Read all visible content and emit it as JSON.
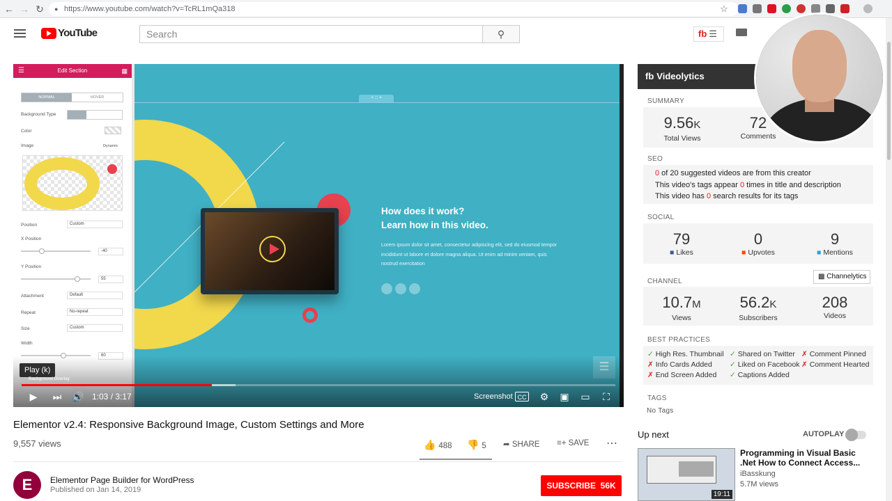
{
  "browser": {
    "url": "https://www.youtube.com/watch?v=TcRL1mQa318"
  },
  "header": {
    "logo_text": "YouTube",
    "search_placeholder": "Search"
  },
  "editor": {
    "panel_title": "Edit Section",
    "tab_normal": "NORMAL",
    "tab_hover": "HOVER",
    "background_type_label": "Background Type",
    "color_label": "Color",
    "image_label": "Image",
    "dynamic_label": "Dynamic",
    "position_label": "Position",
    "position_value": "Custom",
    "x_position_label": "X Position",
    "x_position_value": "-40",
    "y_position_label": "Y Position",
    "y_position_value": "55",
    "attachment_label": "Attachment",
    "attachment_value": "Default",
    "repeat_label": "Repeat",
    "repeat_value": "No-repeat",
    "size_label": "Size",
    "size_value": "Custom",
    "width_label": "Width",
    "width_value": "60",
    "background_overlay_label": "Background Overlay"
  },
  "stage": {
    "hero_title_line1": "How does it work?",
    "hero_title_line2": "Learn how in this video.",
    "hero_body": "Lorem ipsum dolor sit amet, consectetur adipiscing elit, sed do eiusmod tempor incididunt ut labore et dolore magna aliqua. Ut enim ad minim veniam, quis nostrud exercitation",
    "colors": {
      "background": "#40b0c4",
      "yellow": "#f2d84b",
      "red": "#e8414f"
    }
  },
  "player": {
    "tooltip": "Play (k)",
    "time": "1:03 / 3:17",
    "screenshot_label": "Screenshot",
    "progress_fraction": 0.32,
    "buffer_fraction": 0.36
  },
  "video": {
    "title": "Elementor v2.4: Responsive Background Image, Custom Settings and More",
    "views": "9,557 views",
    "likes": "488",
    "dislikes": "5",
    "share_label": "SHARE",
    "save_label": "SAVE"
  },
  "channel": {
    "avatar_letter": "E",
    "name": "Elementor Page Builder for WordPress",
    "published": "Published on Jan 14, 2019",
    "subscribe_label": "SUBSCRIBE",
    "subscriber_count": "56K"
  },
  "videolytics": {
    "title": "Videolytics",
    "summary_label": "SUMMARY",
    "summary": [
      {
        "value": "9.56",
        "suffix": "K",
        "label": "Total Views"
      },
      {
        "value": "72",
        "suffix": "",
        "label": "Comments"
      }
    ],
    "seo_label": "SEO",
    "seo_lines": [
      {
        "num": "0",
        "text": " of 20 suggested videos are from this creator",
        "prefix": ""
      },
      {
        "prefix": "This video's tags appear ",
        "num": "0",
        "text": " times in title and description"
      },
      {
        "prefix": "This video has ",
        "num": "0",
        "text": " search results for its tags"
      }
    ],
    "social_label": "SOCIAL",
    "social": [
      {
        "value": "79",
        "label": "Likes"
      },
      {
        "value": "0",
        "label": "Upvotes"
      },
      {
        "value": "9",
        "label": "Mentions"
      }
    ],
    "channel_label": "CHANNEL",
    "channelytics_button": "Channelytics",
    "channel_stats": [
      {
        "value": "10.7",
        "suffix": "M",
        "label": "Views"
      },
      {
        "value": "56.2",
        "suffix": "K",
        "label": "Subscribers"
      },
      {
        "value": "208",
        "suffix": "",
        "label": "Videos"
      }
    ],
    "best_practices_label": "BEST PRACTICES",
    "best_practices": [
      {
        "ok": true,
        "text": "High Res. Thumbnail"
      },
      {
        "ok": true,
        "text": "Shared on Twitter"
      },
      {
        "ok": false,
        "text": "Comment Pinned"
      },
      {
        "ok": false,
        "text": "Info Cards Added"
      },
      {
        "ok": true,
        "text": "Liked on Facebook"
      },
      {
        "ok": false,
        "text": "Comment Hearted"
      },
      {
        "ok": false,
        "text": "End Screen Added"
      },
      {
        "ok": true,
        "text": "Captions Added"
      }
    ],
    "tags_label": "TAGS",
    "tags_value": "No Tags"
  },
  "upnext": {
    "label": "Up next",
    "autoplay_label": "AUTOPLAY",
    "title": "Programming in Visual Basic .Net How to Connect Access...",
    "channel": "iBasskung",
    "views": "5.7M views",
    "duration": "19:11"
  }
}
